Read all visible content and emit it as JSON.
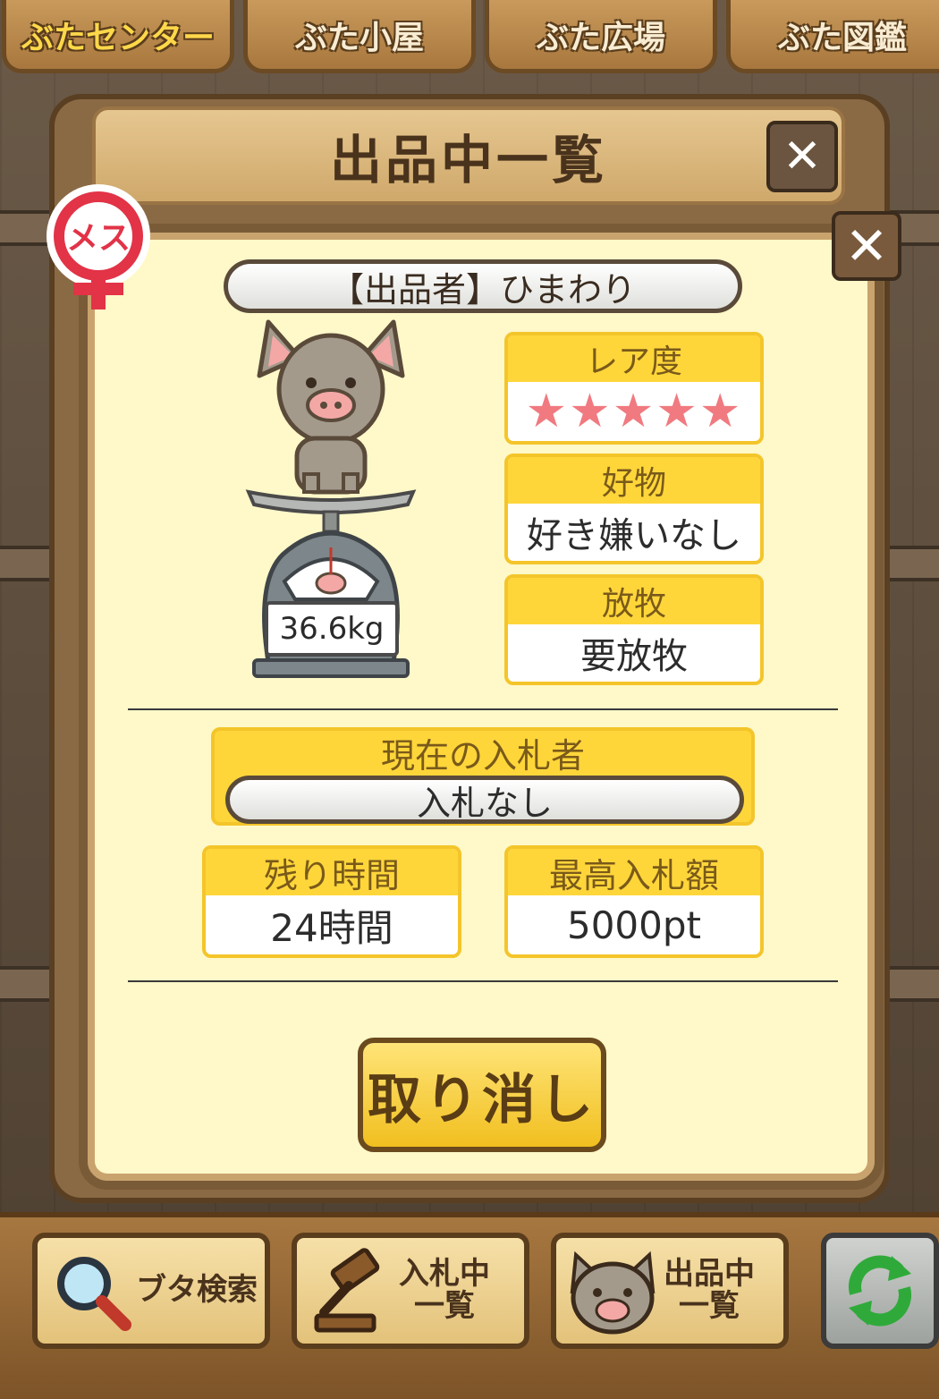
{
  "top_tabs": [
    {
      "label": "ぶたセンター",
      "active": true
    },
    {
      "label": "ぶた小屋",
      "active": false
    },
    {
      "label": "ぶた広場",
      "active": false
    },
    {
      "label": "ぶた図鑑",
      "active": false
    }
  ],
  "dialog": {
    "title": "出品中一覧",
    "close_glyph": "✕"
  },
  "listing": {
    "gender_label": "メス",
    "seller": "【出品者】ひまわり",
    "weight": "36.6kg",
    "rarity": {
      "label": "レア度",
      "stars": "★★★★★",
      "value": 5
    },
    "favorite": {
      "label": "好物",
      "value": "好き嫌いなし"
    },
    "grazing": {
      "label": "放牧",
      "value": "要放牧"
    },
    "current_bidder": {
      "label": "現在の入札者",
      "value": "入札なし"
    },
    "remaining_time": {
      "label": "残り時間",
      "value": "24時間"
    },
    "highest_bid": {
      "label": "最高入札額",
      "value": "5000pt"
    },
    "cancel_label": "取り消し"
  },
  "toolbar": {
    "search": "ブタ検索",
    "bidding_line1": "入札中",
    "bidding_line2": "一覧",
    "listing_line1": "出品中",
    "listing_line2": "一覧"
  },
  "colors": {
    "panel_bg": "#fff8c8",
    "card_header": "#ffd63a",
    "star": "#f07a80",
    "gender_red": "#e23347"
  }
}
